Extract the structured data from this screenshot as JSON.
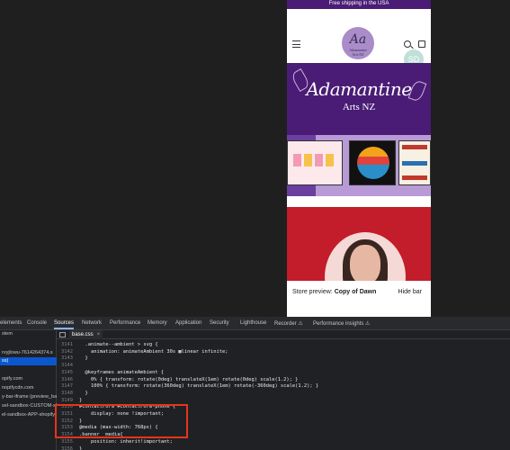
{
  "store": {
    "shipping_bar": "Free shipping in the USA",
    "logo_monogram": "Aa",
    "logo_name": "Adamantine",
    "logo_sub": "Arts NZ",
    "avatar_initials": "SD",
    "banner_title": "Adamantine",
    "banner_subtitle": "Arts NZ",
    "preview_label": "Store preview:",
    "preview_theme": "Copy of Dawn",
    "hide_bar": "Hide bar"
  },
  "devtools": {
    "tabs": [
      "elements",
      "Console",
      "Sources",
      "Network",
      "Performance",
      "Memory",
      "Application",
      "Security",
      "Lighthouse",
      "Recorder ⚠",
      "Performance insights ⚠"
    ],
    "active_tab": "Sources",
    "sidebar": {
      "toggle": "stem",
      "items": [
        "rvyjlowu-7614264374.s",
        "ss)",
        "opify.com",
        "nopifycdn.com",
        "y-bar-iframe (preview_bar)",
        "sel-sandbox-CUSTOM-sh",
        "el-sandbox-APP-shopify-sh"
      ],
      "selected_index": 1
    },
    "file_tab": "base.css",
    "file_close": "×",
    "lines": [
      {
        "n": "3141",
        "code": "  .animate--ambient > svg {"
      },
      {
        "n": "3142",
        "code": "    animation: animateAmbient 30s ▩linear infinite;"
      },
      {
        "n": "3143",
        "code": "  }"
      },
      {
        "n": "3144",
        "code": ""
      },
      {
        "n": "3145",
        "code": "  @keyframes animateAmbient {"
      },
      {
        "n": "3146",
        "code": "    0% { transform: rotate(0deg) translateX(1em) rotate(0deg) scale(1.2); }"
      },
      {
        "n": "3147",
        "code": "    100% { transform: rotate(360deg) translateX(1em) rotate(-360deg) scale(1.2); }"
      },
      {
        "n": "3148",
        "code": "  }"
      },
      {
        "n": "3149",
        "code": "}"
      },
      {
        "n": "3150",
        "code": "#ContactForm #ContactForm-phone {"
      },
      {
        "n": "3151",
        "code": "    display: none !important;"
      },
      {
        "n": "3152",
        "code": "}"
      },
      {
        "n": "3153",
        "code": "@media (max-width: 768px) {"
      },
      {
        "n": "3154",
        "code": ".banner__media{"
      },
      {
        "n": "3155",
        "code": "    position: inherit!important;"
      },
      {
        "n": "3156",
        "code": "}"
      },
      {
        "n": "3157",
        "code": "}"
      },
      {
        "n": "3158",
        "code": ""
      }
    ]
  },
  "colors": {
    "brand_purple": "#4a1c75",
    "highlight_red": "#e8341c",
    "devtools_bg": "#202124",
    "selection_blue": "#0b57d0"
  }
}
